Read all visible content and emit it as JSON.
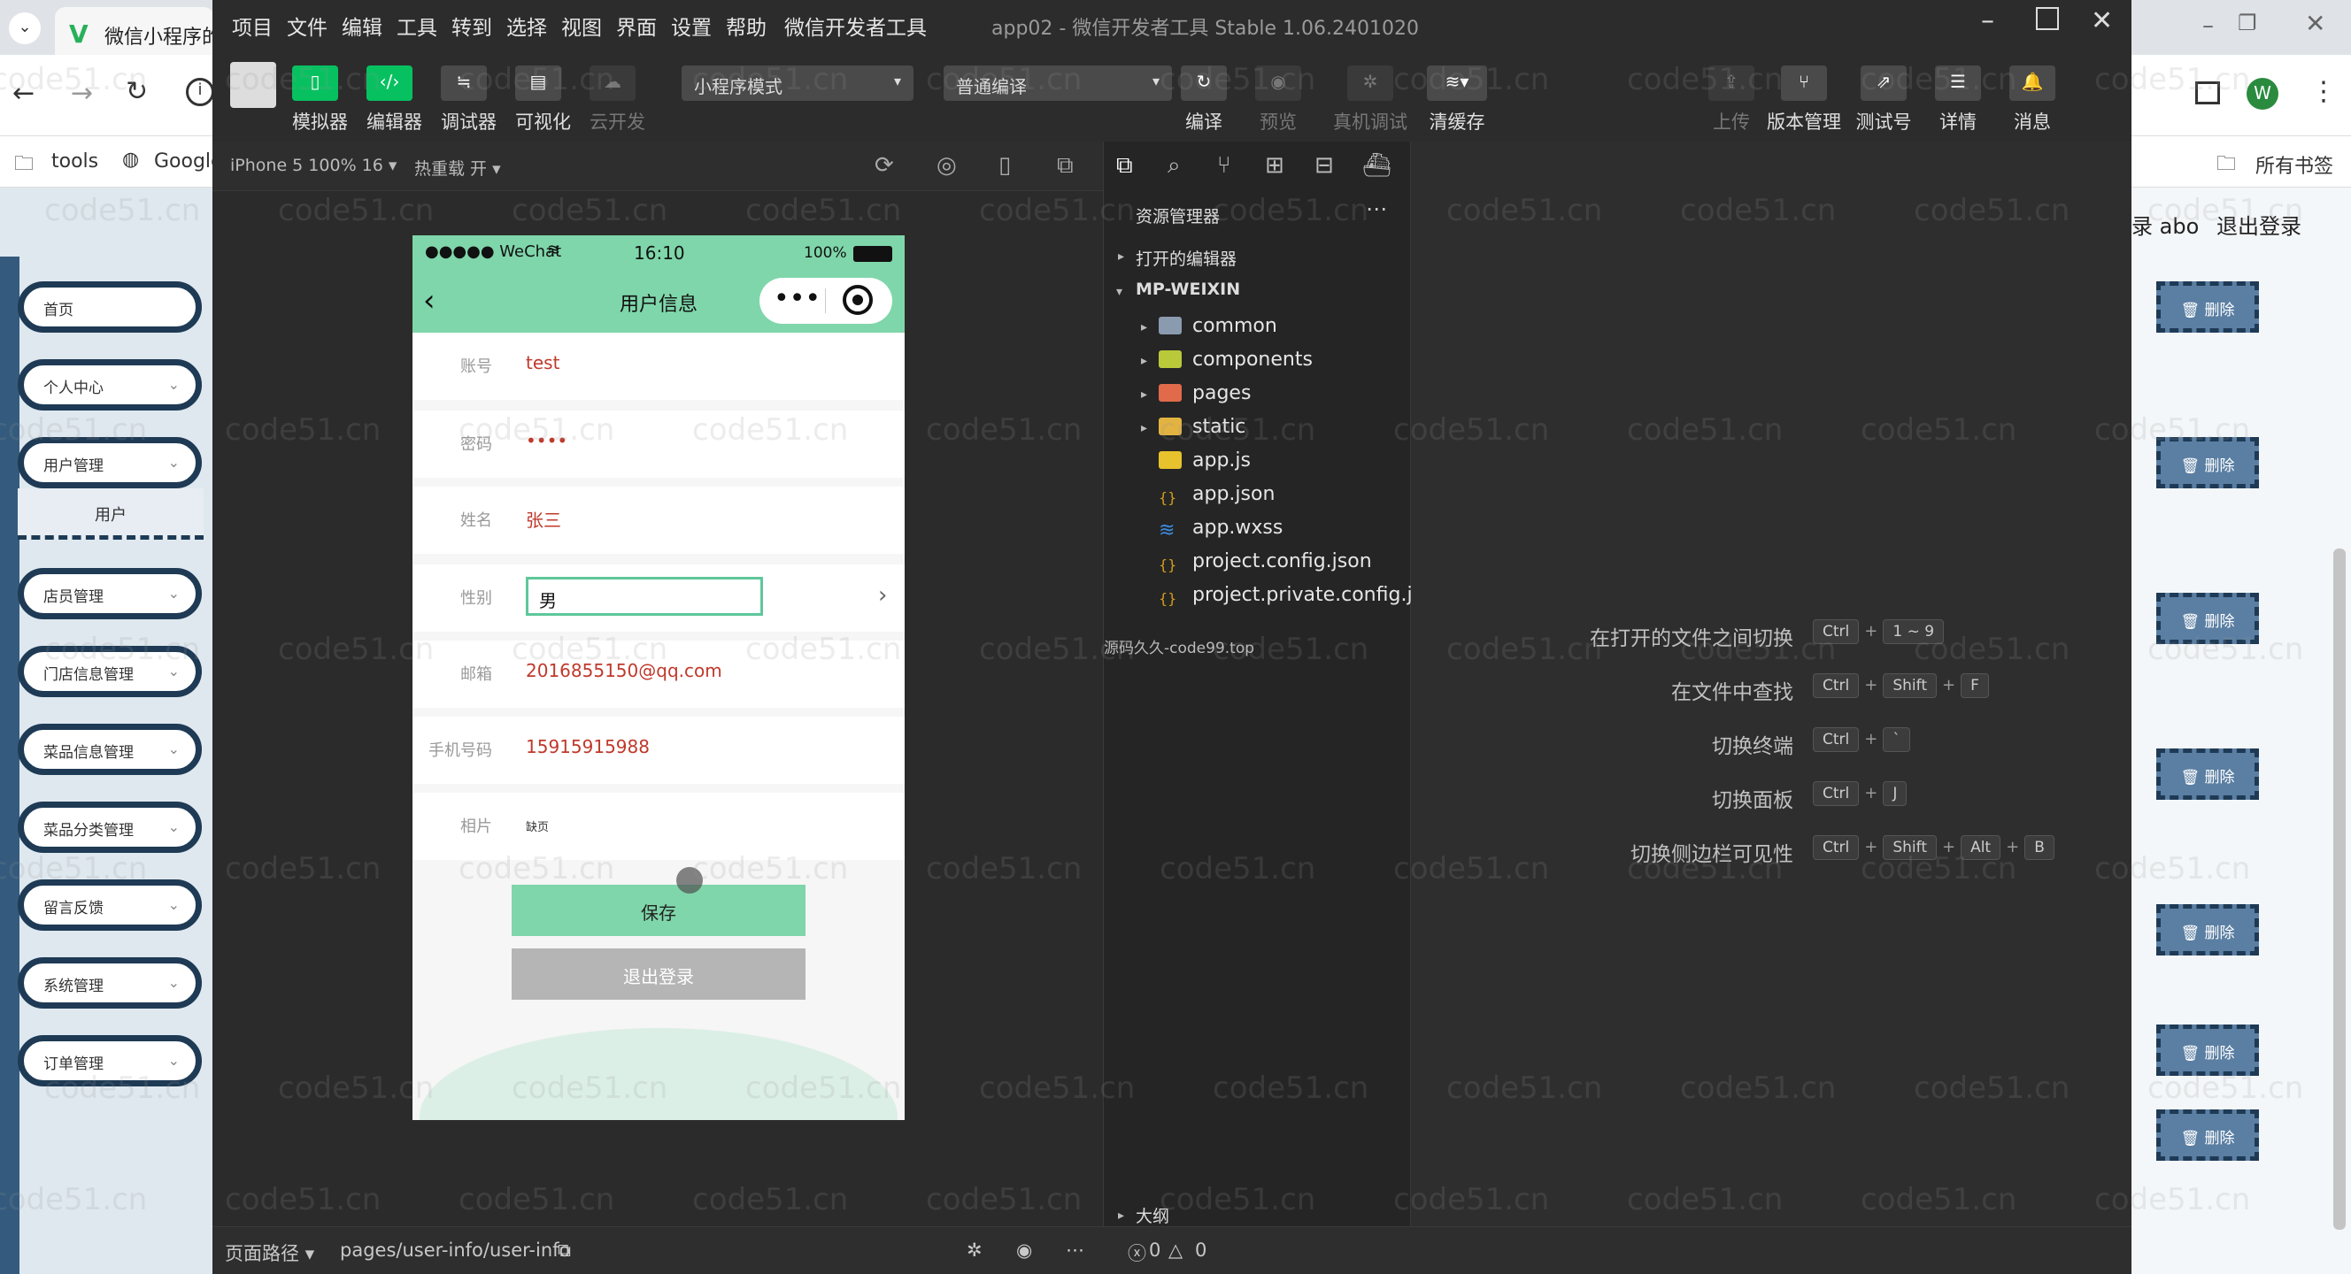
{
  "browser": {
    "tab_title": "微信小程序的",
    "bookmarks": {
      "tools": "tools",
      "google": "Google",
      "all": "所有书签"
    },
    "header_right": {
      "user": "录 abo",
      "logout": "退出登录"
    },
    "avatar_letter": "W",
    "menu": [
      {
        "label": "首页",
        "chev": false
      },
      {
        "label": "个人中心",
        "chev": true
      },
      {
        "label": "用户管理",
        "chev": true
      },
      {
        "label": "店员管理",
        "chev": true
      },
      {
        "label": "门店信息管理",
        "chev": true
      },
      {
        "label": "菜品信息管理",
        "chev": true
      },
      {
        "label": "菜品分类管理",
        "chev": true
      },
      {
        "label": "留言反馈",
        "chev": true
      },
      {
        "label": "系统管理",
        "chev": true
      },
      {
        "label": "订单管理",
        "chev": true
      }
    ],
    "submenu_user": "用户",
    "delete_label": "删除"
  },
  "devtools": {
    "menus": [
      "项目",
      "文件",
      "编辑",
      "工具",
      "转到",
      "选择",
      "视图",
      "界面",
      "设置",
      "帮助",
      "微信开发者工具"
    ],
    "window_title": "app02 - 微信开发者工具 Stable 1.06.2401020",
    "toolbar": {
      "simulator": "模拟器",
      "editor": "编辑器",
      "debugger": "调试器",
      "visual": "可视化",
      "cloud": "云开发",
      "mode": "小程序模式",
      "compile_mode": "普通编译",
      "compile": "编译",
      "preview": "预览",
      "remote_debug": "真机调试",
      "clear_cache": "清缓存",
      "upload": "上传",
      "version": "版本管理",
      "test_account": "测试号",
      "details": "详情",
      "messages": "消息"
    },
    "sim_header": {
      "device": "iPhone 5 100% 16 ▾",
      "hot_reload": "热重载 开 ▾"
    },
    "bottom": {
      "page_path_label": "页面路径 ▾",
      "page_path": "pages/user-info/user-info",
      "errors": "0",
      "warnings": "0"
    }
  },
  "phone": {
    "carrier": "●●●●● WeChat",
    "time": "16:10",
    "battery": "100%",
    "title": "用户信息",
    "fields": [
      {
        "label": "账号",
        "value": "test"
      },
      {
        "label": "密码",
        "value": "••••"
      },
      {
        "label": "姓名",
        "value": "张三"
      },
      {
        "label": "性别",
        "value": "男"
      },
      {
        "label": "邮箱",
        "value": "2016855150@qq.com"
      },
      {
        "label": "手机号码",
        "value": "15915915988"
      },
      {
        "label": "相片",
        "value": "缺页"
      }
    ],
    "save": "保存",
    "logout": "退出登录"
  },
  "explorer": {
    "title": "资源管理器",
    "open_editors": "打开的编辑器",
    "project": "MP-WEIXIN",
    "items": [
      {
        "name": "common",
        "type": "folder"
      },
      {
        "name": "components",
        "type": "folder"
      },
      {
        "name": "pages",
        "type": "folder"
      },
      {
        "name": "static",
        "type": "folder"
      },
      {
        "name": "app.js",
        "type": "js"
      },
      {
        "name": "app.json",
        "type": "json"
      },
      {
        "name": "app.wxss",
        "type": "wxss"
      },
      {
        "name": "project.config.json",
        "type": "json"
      },
      {
        "name": "project.private.config.js...",
        "type": "json"
      }
    ],
    "outline": "大纲",
    "overlay_text": "源码久久-code99.top"
  },
  "shortcuts": [
    {
      "label": "在打开的文件之间切换",
      "keys": [
        "Ctrl",
        "1 ~ 9"
      ]
    },
    {
      "label": "在文件中查找",
      "keys": [
        "Ctrl",
        "Shift",
        "F"
      ]
    },
    {
      "label": "切换终端",
      "keys": [
        "Ctrl",
        "`"
      ]
    },
    {
      "label": "切换面板",
      "keys": [
        "Ctrl",
        "J"
      ]
    },
    {
      "label": "切换侧边栏可见性",
      "keys": [
        "Ctrl",
        "Shift",
        "Alt",
        "B"
      ]
    }
  ],
  "watermark": "code51.cn",
  "colors": {
    "accent_green": "#07c160",
    "phone_header": "#7fd6aa",
    "admin_nav": "#1e3a55",
    "value_red": "#c0392b"
  }
}
